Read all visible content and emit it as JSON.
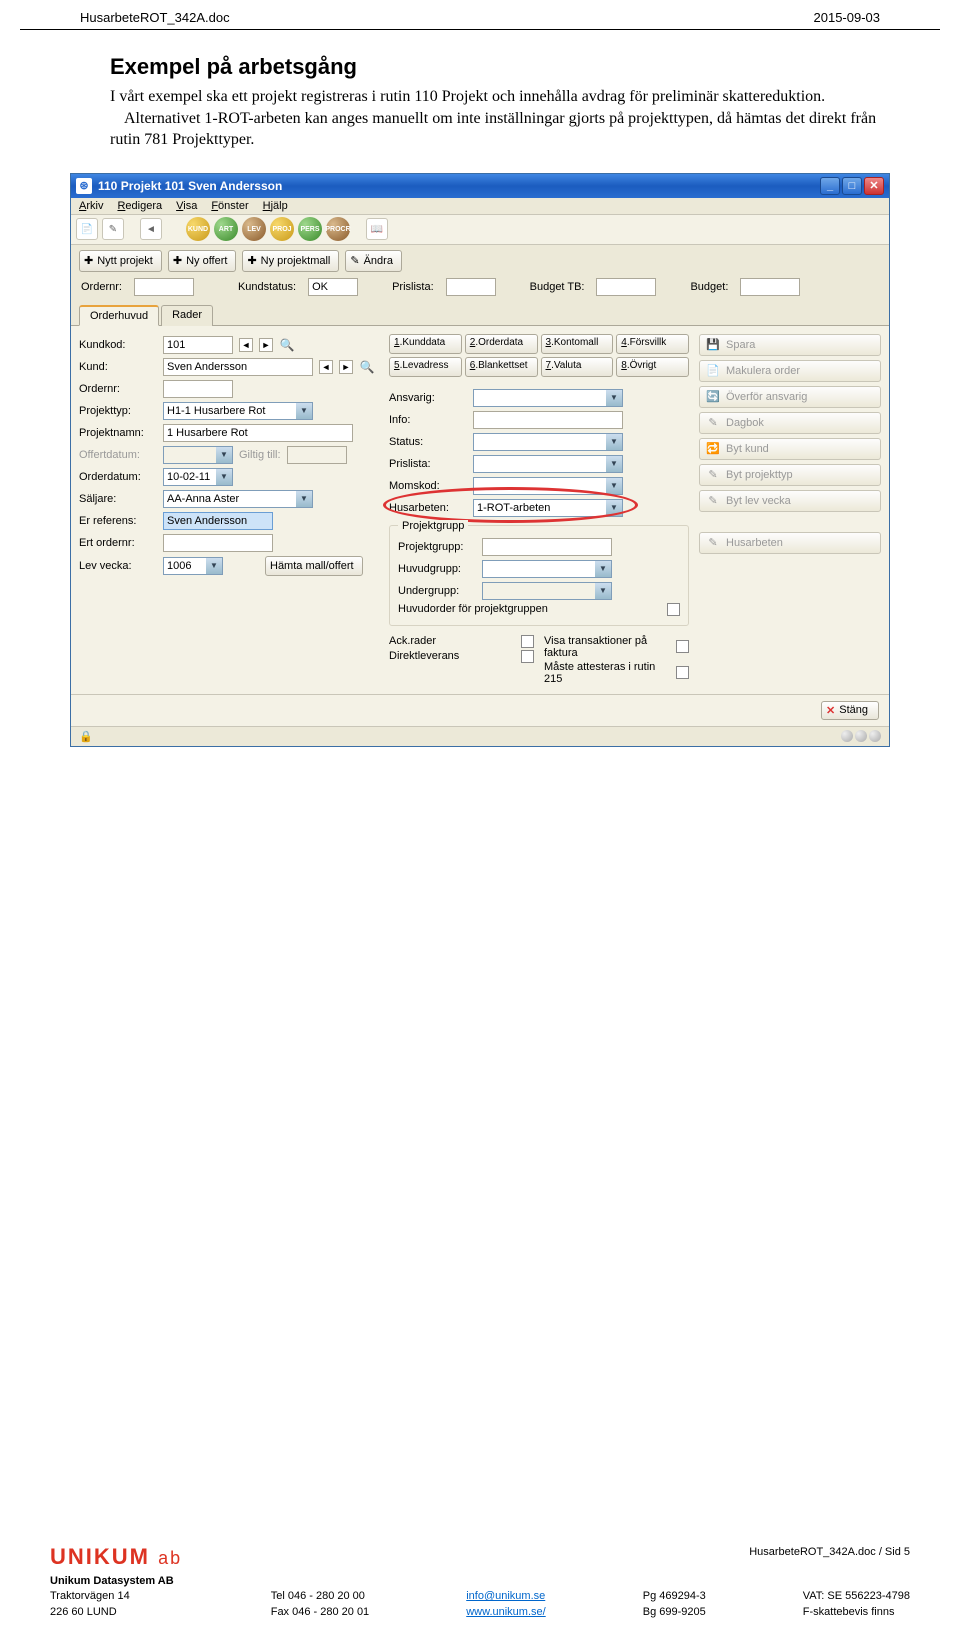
{
  "doc_header": {
    "left": "HusarbeteROT_342A.doc",
    "right": "2015-09-03"
  },
  "heading": "Exempel på arbetsgång",
  "paragraph1": "I vårt exempel ska ett projekt registreras i rutin 110 Projekt och innehålla avdrag för preliminär skattereduktion.",
  "paragraph2": "Alternativet 1-ROT-arbeten kan anges manuellt om inte inställningar gjorts på projekttypen, då hämtas det direkt från rutin 781 Projekttyper.",
  "app": {
    "title": "110 Projekt  101  Sven Andersson",
    "menu": [
      "Arkiv",
      "Redigera",
      "Visa",
      "Fönster",
      "Hjälp"
    ],
    "toolbar_circles": [
      "KUND",
      "ART",
      "LEV",
      "PROJ",
      "PERS",
      "PROCR"
    ],
    "topbtns": [
      {
        "icon": "✚",
        "label": "Nytt projekt"
      },
      {
        "icon": "✚",
        "label": "Ny offert"
      },
      {
        "icon": "✚",
        "label": "Ny projektmall"
      },
      {
        "icon": "✎",
        "label": "Ändra"
      }
    ],
    "orderline": {
      "ordernr_label": "Ordernr:",
      "kundstatus_label": "Kundstatus:",
      "kundstatus": "OK",
      "prislista_label": "Prislista:",
      "budgettb_label": "Budget TB:",
      "budget_label": "Budget:"
    },
    "tabs": [
      "Orderhuvud",
      "Rader"
    ],
    "left": {
      "kundkod_label": "Kundkod:",
      "kundkod": "101",
      "kund_label": "Kund:",
      "kund": "Sven Andersson",
      "ordernr_label": "Ordernr:",
      "projekttyp_label": "Projekttyp:",
      "projekttyp": "H1-1 Husarbere Rot",
      "projektnamn_label": "Projektnamn:",
      "projektnamn": "1 Husarbere Rot",
      "offertdatum_label": "Offertdatum:",
      "giltig_label": "Giltig till:",
      "orderdatum_label": "Orderdatum:",
      "orderdatum": "10-02-11",
      "saljare_label": "Säljare:",
      "saljare": "AA-Anna Aster",
      "erref_label": "Er referens:",
      "erref": "Sven Andersson",
      "ertorder_label": "Ert ordernr:",
      "levvecka_label": "Lev vecka:",
      "levvecka": "1006",
      "hamta_label": "Hämta mall/offert"
    },
    "cats": [
      "1.Kunddata",
      "2.Orderdata",
      "3.Kontomall",
      "4.Försvillk",
      "5.Levadress",
      "6.Blankettset",
      "7.Valuta",
      "8.Övrigt"
    ],
    "mid": {
      "ansvarig_label": "Ansvarig:",
      "info_label": "Info:",
      "status_label": "Status:",
      "prislista_label": "Prislista:",
      "momskod_label": "Momskod:",
      "husarbeten_label": "Husarbeten:",
      "husarbeten": "1-ROT-arbeten",
      "fieldset_title": "Projektgrupp",
      "projektgrupp_label": "Projektgrupp:",
      "huvudgrupp_label": "Huvudgrupp:",
      "undergrupp_label": "Undergrupp:",
      "huvudorder_label": "Huvudorder för projektgruppen",
      "ackrader": "Ack.rader",
      "direktlev": "Direktleverans",
      "visatrans": "Visa transaktioner på faktura",
      "masteatt": "Måste attesteras i rutin 215"
    },
    "side": [
      {
        "icon": "💾",
        "label": "Spara"
      },
      {
        "icon": "📄",
        "label": "Makulera order"
      },
      {
        "icon": "🔄",
        "label": "Överför ansvarig"
      },
      {
        "icon": "✎",
        "label": "Dagbok"
      },
      {
        "icon": "🔁",
        "label": "Byt kund"
      },
      {
        "icon": "✎",
        "label": "Byt projekttyp"
      },
      {
        "icon": "✎",
        "label": "Byt lev vecka"
      },
      {
        "icon": "✎",
        "label": "Husarbeten"
      }
    ],
    "stang": "Stäng"
  },
  "footer": {
    "right_top": "HusarbeteROT_342A.doc / Sid 5",
    "logo": "UNIKUM",
    "logo_ab": "ab",
    "company": "Unikum Datasystem AB",
    "addr1": "Traktorvägen 14",
    "addr2": "226 60  LUND",
    "tel": "Tel  046 - 280 20 00",
    "fax": "Fax  046 - 280 20 01",
    "mail": "info@unikum.se",
    "web": "www.unikum.se/",
    "pg": "Pg  469294-3",
    "bg": "Bg  699-9205",
    "vat": "VAT: SE 556223-4798",
    "fskatt": "F-skattebevis finns"
  }
}
